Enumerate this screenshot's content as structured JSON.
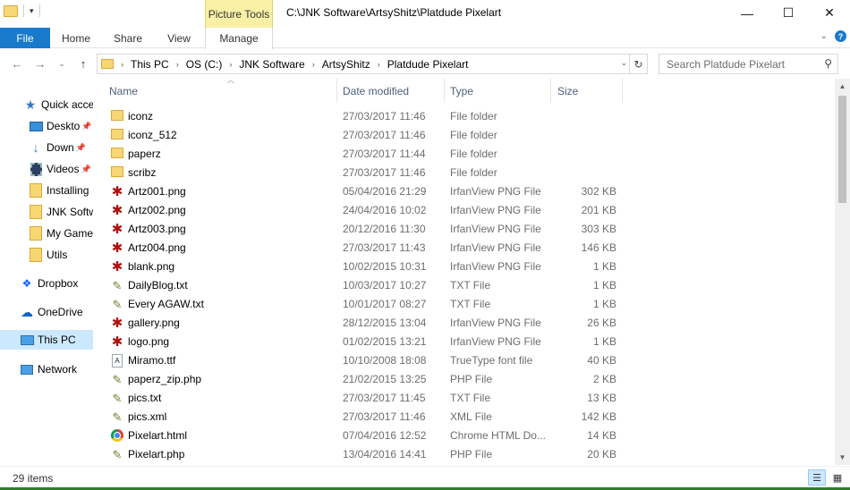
{
  "titlebar": {
    "context_tab": "Picture Tools",
    "title": "C:\\JNK Software\\ArtsyShitz\\Platdude Pixelart",
    "minimize": "—",
    "maximize": "☐",
    "close": "✕"
  },
  "ribbon": {
    "tabs": [
      "File",
      "Home",
      "Share",
      "View",
      "Manage"
    ]
  },
  "address": {
    "crumbs": [
      "This PC",
      "OS (C:)",
      "JNK Software",
      "ArtsyShitz",
      "Platdude Pixelart"
    ],
    "search_placeholder": "Search Platdude Pixelart"
  },
  "navpane": {
    "items": [
      {
        "label": "Quick access",
        "icon": "star-icon",
        "pinned": false
      },
      {
        "label": "Desktop",
        "icon": "desktop-icon",
        "pinned": true
      },
      {
        "label": "Downloads",
        "icon": "download-icon",
        "pinned": true
      },
      {
        "label": "Videos",
        "icon": "video-icon",
        "pinned": true
      },
      {
        "label": "Installing",
        "icon": "folder-icon",
        "pinned": false
      },
      {
        "label": "JNK Software",
        "icon": "folder-icon",
        "pinned": false
      },
      {
        "label": "My Games",
        "icon": "folder-icon",
        "pinned": false
      },
      {
        "label": "Utils",
        "icon": "folder-icon",
        "pinned": false
      },
      {
        "label": "Dropbox",
        "icon": "dropbox-icon",
        "pinned": false
      },
      {
        "label": "OneDrive",
        "icon": "onedrive-icon",
        "pinned": false
      },
      {
        "label": "This PC",
        "icon": "this-pc-icon",
        "pinned": false
      },
      {
        "label": "Network",
        "icon": "network-icon",
        "pinned": false
      }
    ],
    "visible_labels": [
      "Quick acce",
      "Deskto",
      "Down",
      "Videos",
      "Installing",
      "JNK Softw",
      "My Game",
      "Utils",
      "Dropbox",
      "OneDrive",
      "This PC",
      "Network"
    ]
  },
  "columns": {
    "name": "Name",
    "date": "Date modified",
    "type": "Type",
    "size": "Size"
  },
  "files": [
    {
      "name": "iconz",
      "date": "27/03/2017 11:46",
      "type": "File folder",
      "size": "",
      "kind": "folder"
    },
    {
      "name": "iconz_512",
      "date": "27/03/2017 11:46",
      "type": "File folder",
      "size": "",
      "kind": "folder"
    },
    {
      "name": "paperz",
      "date": "27/03/2017 11:44",
      "type": "File folder",
      "size": "",
      "kind": "folder"
    },
    {
      "name": "scribz",
      "date": "27/03/2017 11:46",
      "type": "File folder",
      "size": "",
      "kind": "folder"
    },
    {
      "name": "Artz001.png",
      "date": "05/04/2016 21:29",
      "type": "IrfanView PNG File",
      "size": "302 KB",
      "kind": "png"
    },
    {
      "name": "Artz002.png",
      "date": "24/04/2016 10:02",
      "type": "IrfanView PNG File",
      "size": "201 KB",
      "kind": "png"
    },
    {
      "name": "Artz003.png",
      "date": "20/12/2016 11:30",
      "type": "IrfanView PNG File",
      "size": "303 KB",
      "kind": "png"
    },
    {
      "name": "Artz004.png",
      "date": "27/03/2017 11:43",
      "type": "IrfanView PNG File",
      "size": "146 KB",
      "kind": "png"
    },
    {
      "name": "blank.png",
      "date": "10/02/2015 10:31",
      "type": "IrfanView PNG File",
      "size": "1 KB",
      "kind": "png"
    },
    {
      "name": "DailyBlog.txt",
      "date": "10/03/2017 10:27",
      "type": "TXT File",
      "size": "1 KB",
      "kind": "txt"
    },
    {
      "name": "Every AGAW.txt",
      "date": "10/01/2017 08:27",
      "type": "TXT File",
      "size": "1 KB",
      "kind": "txt"
    },
    {
      "name": "gallery.png",
      "date": "28/12/2015 13:04",
      "type": "IrfanView PNG File",
      "size": "26 KB",
      "kind": "png"
    },
    {
      "name": "logo.png",
      "date": "01/02/2015 13:21",
      "type": "IrfanView PNG File",
      "size": "1 KB",
      "kind": "png"
    },
    {
      "name": "Miramo.ttf",
      "date": "10/10/2008 18:08",
      "type": "TrueType font file",
      "size": "40 KB",
      "kind": "ttf"
    },
    {
      "name": "paperz_zip.php",
      "date": "21/02/2015 13:25",
      "type": "PHP File",
      "size": "2 KB",
      "kind": "txt"
    },
    {
      "name": "pics.txt",
      "date": "27/03/2017 11:45",
      "type": "TXT File",
      "size": "13 KB",
      "kind": "txt"
    },
    {
      "name": "pics.xml",
      "date": "27/03/2017 11:46",
      "type": "XML File",
      "size": "142 KB",
      "kind": "txt"
    },
    {
      "name": "Pixelart.html",
      "date": "07/04/2016 12:52",
      "type": "Chrome HTML Do...",
      "size": "14 KB",
      "kind": "chrome"
    },
    {
      "name": "Pixelart.php",
      "date": "13/04/2016 14:41",
      "type": "PHP File",
      "size": "20 KB",
      "kind": "txt"
    }
  ],
  "status": {
    "item_count": "29 items"
  },
  "colors": {
    "file_tab": "#1979ca",
    "context_tab": "#f9f0a6",
    "selection": "#cce8ff",
    "png_icon": "#b01010"
  }
}
